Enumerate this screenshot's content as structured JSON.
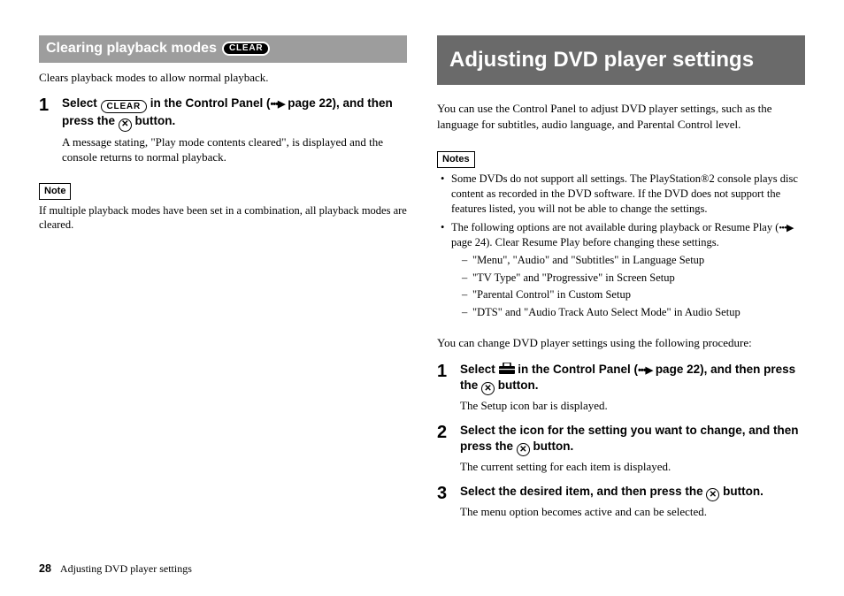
{
  "left": {
    "heading": "Clearing playback modes",
    "clear_badge": "CLEAR",
    "intro": "Clears playback modes to allow normal playback.",
    "step1": {
      "num": "1",
      "title_a": "Select ",
      "title_b": " in the Control Panel (",
      "title_c": " page 22), and then press the ",
      "title_d": " button.",
      "desc": "A message stating, \"Play mode contents cleared\", is displayed and the console returns to normal playback."
    },
    "note_label": "Note",
    "note_text": "If multiple playback modes have been set in a combination, all playback modes are cleared."
  },
  "right": {
    "heading": "Adjusting DVD player settings",
    "intro": "You can use the Control Panel to adjust DVD player settings, such as the language for subtitles, audio language, and Parental Control level.",
    "notes_label": "Notes",
    "bullet1": "Some DVDs do not support all settings. The PlayStation®2 console plays disc content as recorded in the DVD software. If the DVD does not support the features listed, you will not be able to change the settings.",
    "bullet2_a": "The following options are not available during playback or Resume Play (",
    "bullet2_b": " page 24). Clear Resume Play before changing these settings.",
    "sub1": "\"Menu\", \"Audio\" and \"Subtitles\" in Language Setup",
    "sub2": "\"TV Type\" and \"Progressive\" in Screen Setup",
    "sub3": "\"Parental Control\" in Custom Setup",
    "sub4": "\"DTS\" and \"Audio Track Auto Select Mode\" in Audio Setup",
    "procedure_intro": "You can change DVD player settings using the following procedure:",
    "step1": {
      "num": "1",
      "title_a": "Select ",
      "title_b": " in the Control Panel (",
      "title_c": " page 22), and then press the ",
      "title_d": " button.",
      "desc": "The Setup icon bar is displayed."
    },
    "step2": {
      "num": "2",
      "title_a": "Select the icon for the setting you want to change, and then press the ",
      "title_b": " button.",
      "desc": "The current setting for each item is displayed."
    },
    "step3": {
      "num": "3",
      "title_a": "Select the desired item, and then press the ",
      "title_b": " button.",
      "desc": "The menu option becomes active and can be selected."
    }
  },
  "footer": {
    "page": "28",
    "title": "Adjusting DVD player settings"
  },
  "glyphs": {
    "xref": "•••▶",
    "x": "✕"
  }
}
